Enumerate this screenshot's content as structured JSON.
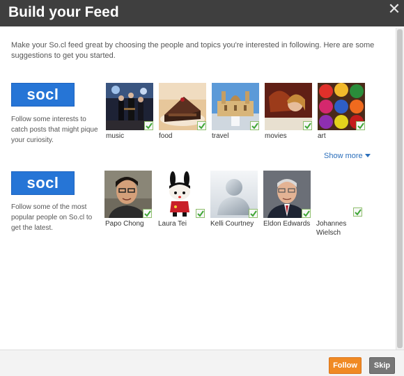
{
  "dialog": {
    "title": "Build your Feed",
    "close_glyph": "✕",
    "intro": "Make your So.cl feed great by choosing the people and topics you're interested in following. Here are some suggestions to get you started."
  },
  "interests": {
    "logo_text": "socl",
    "description": "Follow some interests to catch posts that might pique your curiosity.",
    "items": [
      {
        "label": "music",
        "icon": "concert-photo"
      },
      {
        "label": "food",
        "icon": "chocolate-cake-photo"
      },
      {
        "label": "travel",
        "icon": "palace-photo"
      },
      {
        "label": "movies",
        "icon": "film-still-photo"
      },
      {
        "label": "art",
        "icon": "paint-pigments-photo"
      }
    ],
    "show_more": "Show more"
  },
  "people": {
    "logo_text": "socl",
    "description": "Follow some of the most popular people on So.cl to get the latest.",
    "items": [
      {
        "label": "Papo Chong",
        "icon": "person-photo"
      },
      {
        "label": "Laura Tei",
        "icon": "bunny-figure-avatar"
      },
      {
        "label": "Kelli Courtney",
        "icon": "default-user-avatar"
      },
      {
        "label": "Eldon Edwards",
        "icon": "person-photo"
      },
      {
        "label": "Johannes Wielsch",
        "icon": "no-avatar"
      }
    ]
  },
  "footer": {
    "follow_label": "Follow",
    "skip_label": "Skip"
  },
  "colors": {
    "titlebar": "#3f3f3f",
    "socl_blue": "#2675d6",
    "follow_orange": "#f08a24",
    "skip_gray": "#777777",
    "link_blue": "#2a6ebb",
    "check_green": "#3fa636"
  }
}
